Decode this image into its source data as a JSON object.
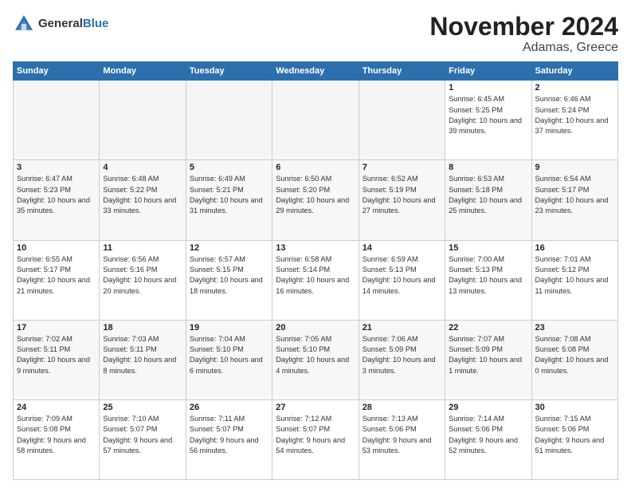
{
  "header": {
    "logo_general": "General",
    "logo_blue": "Blue",
    "month": "November 2024",
    "location": "Adamas, Greece"
  },
  "weekdays": [
    "Sunday",
    "Monday",
    "Tuesday",
    "Wednesday",
    "Thursday",
    "Friday",
    "Saturday"
  ],
  "weeks": [
    [
      {
        "day": "",
        "info": ""
      },
      {
        "day": "",
        "info": ""
      },
      {
        "day": "",
        "info": ""
      },
      {
        "day": "",
        "info": ""
      },
      {
        "day": "",
        "info": ""
      },
      {
        "day": "1",
        "info": "Sunrise: 6:45 AM\nSunset: 5:25 PM\nDaylight: 10 hours and 39 minutes."
      },
      {
        "day": "2",
        "info": "Sunrise: 6:46 AM\nSunset: 5:24 PM\nDaylight: 10 hours and 37 minutes."
      }
    ],
    [
      {
        "day": "3",
        "info": "Sunrise: 6:47 AM\nSunset: 5:23 PM\nDaylight: 10 hours and 35 minutes."
      },
      {
        "day": "4",
        "info": "Sunrise: 6:48 AM\nSunset: 5:22 PM\nDaylight: 10 hours and 33 minutes."
      },
      {
        "day": "5",
        "info": "Sunrise: 6:49 AM\nSunset: 5:21 PM\nDaylight: 10 hours and 31 minutes."
      },
      {
        "day": "6",
        "info": "Sunrise: 6:50 AM\nSunset: 5:20 PM\nDaylight: 10 hours and 29 minutes."
      },
      {
        "day": "7",
        "info": "Sunrise: 6:52 AM\nSunset: 5:19 PM\nDaylight: 10 hours and 27 minutes."
      },
      {
        "day": "8",
        "info": "Sunrise: 6:53 AM\nSunset: 5:18 PM\nDaylight: 10 hours and 25 minutes."
      },
      {
        "day": "9",
        "info": "Sunrise: 6:54 AM\nSunset: 5:17 PM\nDaylight: 10 hours and 23 minutes."
      }
    ],
    [
      {
        "day": "10",
        "info": "Sunrise: 6:55 AM\nSunset: 5:17 PM\nDaylight: 10 hours and 21 minutes."
      },
      {
        "day": "11",
        "info": "Sunrise: 6:56 AM\nSunset: 5:16 PM\nDaylight: 10 hours and 20 minutes."
      },
      {
        "day": "12",
        "info": "Sunrise: 6:57 AM\nSunset: 5:15 PM\nDaylight: 10 hours and 18 minutes."
      },
      {
        "day": "13",
        "info": "Sunrise: 6:58 AM\nSunset: 5:14 PM\nDaylight: 10 hours and 16 minutes."
      },
      {
        "day": "14",
        "info": "Sunrise: 6:59 AM\nSunset: 5:13 PM\nDaylight: 10 hours and 14 minutes."
      },
      {
        "day": "15",
        "info": "Sunrise: 7:00 AM\nSunset: 5:13 PM\nDaylight: 10 hours and 13 minutes."
      },
      {
        "day": "16",
        "info": "Sunrise: 7:01 AM\nSunset: 5:12 PM\nDaylight: 10 hours and 11 minutes."
      }
    ],
    [
      {
        "day": "17",
        "info": "Sunrise: 7:02 AM\nSunset: 5:11 PM\nDaylight: 10 hours and 9 minutes."
      },
      {
        "day": "18",
        "info": "Sunrise: 7:03 AM\nSunset: 5:11 PM\nDaylight: 10 hours and 8 minutes."
      },
      {
        "day": "19",
        "info": "Sunrise: 7:04 AM\nSunset: 5:10 PM\nDaylight: 10 hours and 6 minutes."
      },
      {
        "day": "20",
        "info": "Sunrise: 7:05 AM\nSunset: 5:10 PM\nDaylight: 10 hours and 4 minutes."
      },
      {
        "day": "21",
        "info": "Sunrise: 7:06 AM\nSunset: 5:09 PM\nDaylight: 10 hours and 3 minutes."
      },
      {
        "day": "22",
        "info": "Sunrise: 7:07 AM\nSunset: 5:09 PM\nDaylight: 10 hours and 1 minute."
      },
      {
        "day": "23",
        "info": "Sunrise: 7:08 AM\nSunset: 5:08 PM\nDaylight: 10 hours and 0 minutes."
      }
    ],
    [
      {
        "day": "24",
        "info": "Sunrise: 7:09 AM\nSunset: 5:08 PM\nDaylight: 9 hours and 58 minutes."
      },
      {
        "day": "25",
        "info": "Sunrise: 7:10 AM\nSunset: 5:07 PM\nDaylight: 9 hours and 57 minutes."
      },
      {
        "day": "26",
        "info": "Sunrise: 7:11 AM\nSunset: 5:07 PM\nDaylight: 9 hours and 56 minutes."
      },
      {
        "day": "27",
        "info": "Sunrise: 7:12 AM\nSunset: 5:07 PM\nDaylight: 9 hours and 54 minutes."
      },
      {
        "day": "28",
        "info": "Sunrise: 7:13 AM\nSunset: 5:06 PM\nDaylight: 9 hours and 53 minutes."
      },
      {
        "day": "29",
        "info": "Sunrise: 7:14 AM\nSunset: 5:06 PM\nDaylight: 9 hours and 52 minutes."
      },
      {
        "day": "30",
        "info": "Sunrise: 7:15 AM\nSunset: 5:06 PM\nDaylight: 9 hours and 51 minutes."
      }
    ]
  ]
}
